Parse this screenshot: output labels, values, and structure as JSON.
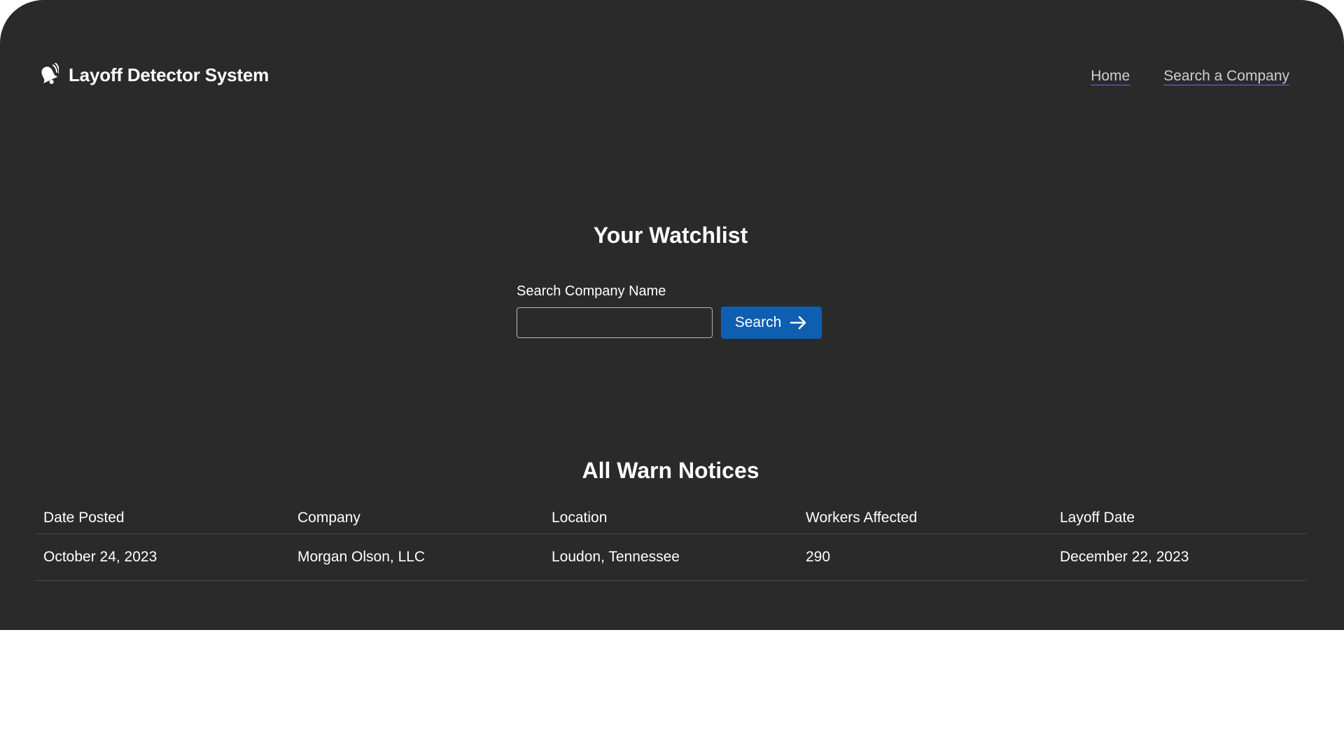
{
  "header": {
    "brand_title": "Layoff Detector System",
    "brand_icon": "bell-icon",
    "nav": [
      {
        "label": "Home"
      },
      {
        "label": "Search a Company"
      }
    ]
  },
  "watchlist": {
    "heading": "Your Watchlist",
    "search_label": "Search Company Name",
    "search_value": "",
    "search_button_label": "Search",
    "search_button_icon": "arrow-right-icon"
  },
  "notices": {
    "heading": "All Warn Notices",
    "columns": [
      "Date Posted",
      "Company",
      "Location",
      "Workers Affected",
      "Layoff Date"
    ],
    "rows": [
      [
        "October 24, 2023",
        "Morgan Olson, LLC",
        "Loudon, Tennessee",
        "290",
        "December 22, 2023"
      ]
    ]
  },
  "colors": {
    "background": "#2a2a2a",
    "button": "#0f5fb0",
    "link_underline": "#8b5cf6"
  }
}
